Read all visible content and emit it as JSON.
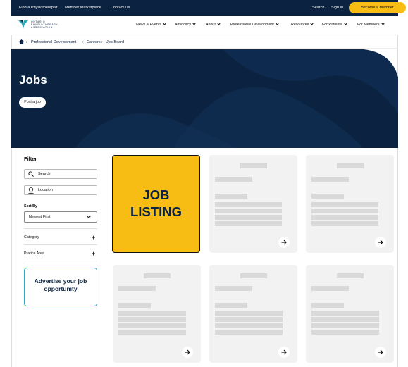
{
  "topbar": {
    "links": [
      "Find a Physiotherapist",
      "Member Marketplace",
      "Contact Us"
    ],
    "search": "Search",
    "sign_in": "Sign In",
    "become_member": "Become a Member"
  },
  "logo": {
    "lines": [
      "ONTARIO",
      "PHYSIOTHERAPY",
      "ASSOCIATION"
    ]
  },
  "nav": [
    "News & Events",
    "Advocacy",
    "About",
    "Professional Development",
    "Resources",
    "For Patients",
    "For Members"
  ],
  "breadcrumb": [
    "Professional Development",
    "Careers",
    "Job Board"
  ],
  "hero": {
    "title": "Jobs",
    "post_button": "Post a job"
  },
  "filter": {
    "title": "Filter",
    "search_placeholder": "Search",
    "location_placeholder": "Location",
    "sort_label": "Sort By",
    "sort_value": "Newest First",
    "category": "Category",
    "practice_area": "Pratice Area",
    "advertise": "Advertise your job opportunity"
  },
  "featured_card": {
    "line1": "JOB",
    "line2": "LISTING"
  },
  "colors": {
    "navy": "#0b2340",
    "accent": "#f7bd14",
    "teal": "#2aa8b8",
    "card_bg": "#f3f2f2",
    "placeholder": "#d9d9d9"
  },
  "icons": [
    "home-icon",
    "search-icon",
    "location-icon",
    "chevron-down-icon",
    "plus-icon",
    "arrow-right-icon"
  ]
}
